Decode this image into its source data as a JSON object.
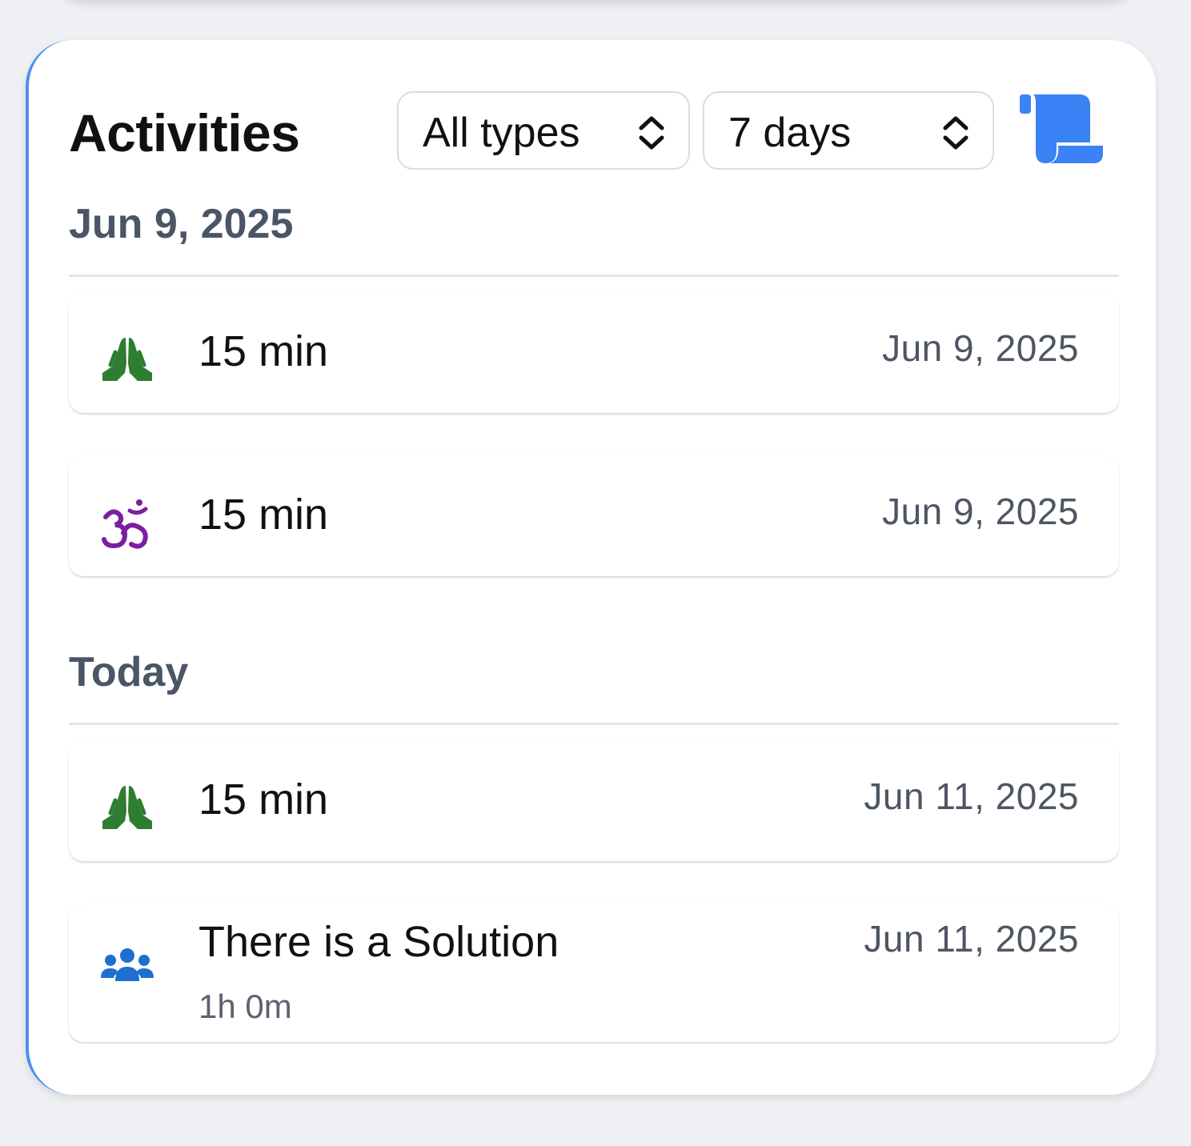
{
  "header": {
    "title": "Activities",
    "type_filter": "All types",
    "range_filter": "7 days",
    "export_icon": "scroll-icon"
  },
  "colors": {
    "accent": "#3b82f6",
    "prayer": "#2e7d32",
    "om": "#7b1fa2",
    "group": "#1e6fd0"
  },
  "groups": [
    {
      "heading": "Jun 9, 2025",
      "items": [
        {
          "icon": "praying-hands-icon",
          "label": "15 min",
          "date": "Jun 9, 2025"
        },
        {
          "icon": "om-symbol-icon",
          "label": "15 min",
          "date": "Jun 9, 2025"
        }
      ]
    },
    {
      "heading": "Today",
      "items": [
        {
          "icon": "praying-hands-icon",
          "label": "15 min",
          "date": "Jun 11, 2025"
        },
        {
          "icon": "group-icon",
          "label": "There is a Solution",
          "sub": "1h 0m",
          "date": "Jun 11, 2025"
        }
      ]
    }
  ]
}
